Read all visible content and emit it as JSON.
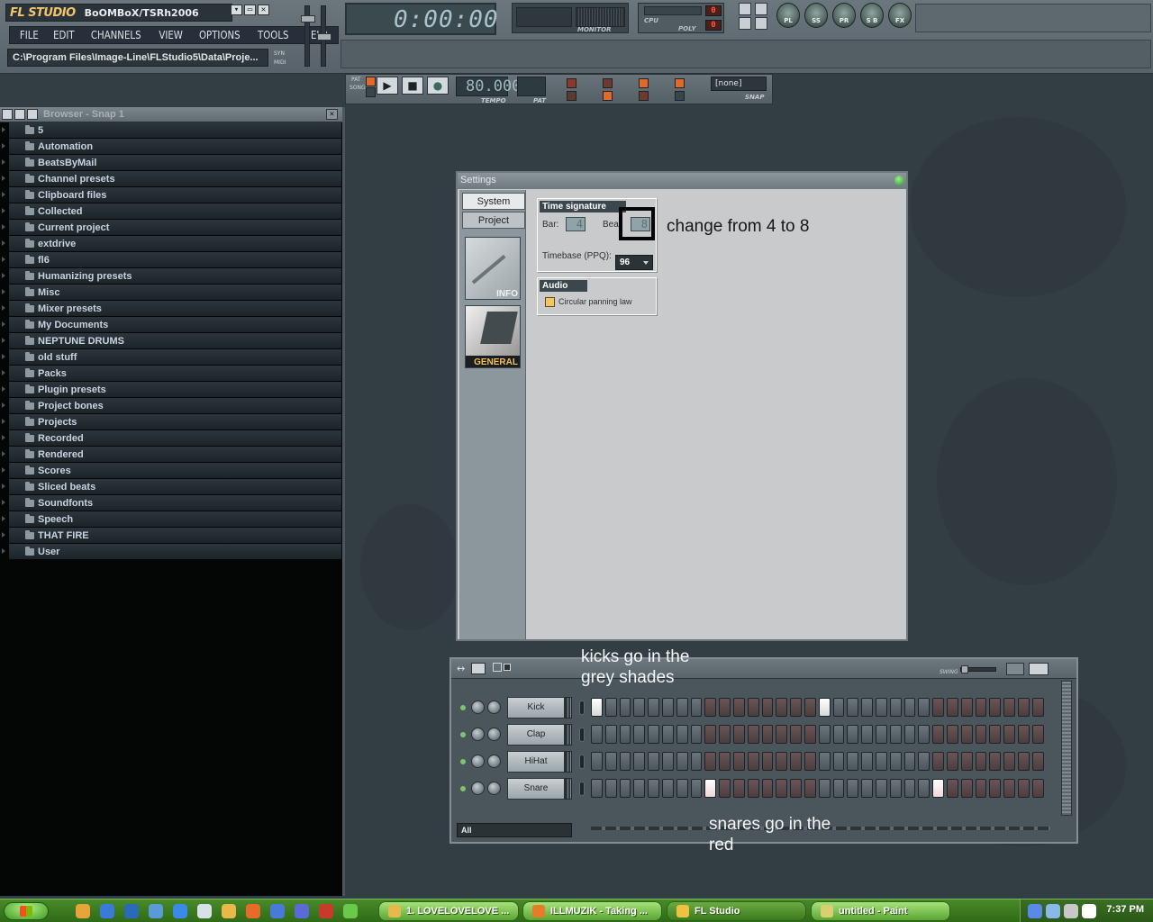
{
  "app": {
    "brand": "FL STUDIO",
    "project_name": "BoOMBoX/TSRh2006",
    "path": "C:\\Program Files\\Image-Line\\FLStudio5\\Data\\Proje...",
    "window_buttons": [
      "▾",
      "▭",
      "✕"
    ],
    "menu": [
      "FILE",
      "EDIT",
      "CHANNELS",
      "VIEW",
      "OPTIONS",
      "TOOLS",
      "HELP"
    ],
    "syn_label": "SYN",
    "midi_label": "MIDI"
  },
  "displays": {
    "time": "0:00:00",
    "monitor_label": "MONITOR",
    "cpu_label": "CPU",
    "poly_label": "POLY",
    "cpu_value": "0",
    "poly_value": "0",
    "view_buttons": [
      "PL",
      "SS",
      "PR",
      "S B",
      "FX"
    ]
  },
  "transport": {
    "pat_label": "PAT",
    "song_label": "SONG",
    "tempo_value": "80.000",
    "tempo_label": "TEMPO",
    "pat_label2": "PAT",
    "snap_value": "[none]",
    "snap_label": "SNAP",
    "play_icon": "▶",
    "stop_icon": "■",
    "record_icon": "●"
  },
  "browser": {
    "title": "Browser - Snap 1",
    "close": "✕",
    "items": [
      "5",
      "Automation",
      "BeatsByMail",
      "Channel presets",
      "Clipboard files",
      "Collected",
      "Current project",
      "extdrive",
      "fl6",
      "Humanizing presets",
      "Misc",
      "Mixer presets",
      "My Documents",
      "NEPTUNE DRUMS",
      "old stuff",
      "Packs",
      "Plugin presets",
      "Project bones",
      "Projects",
      "Recorded",
      "Rendered",
      "Scores",
      "Sliced beats",
      "Soundfonts",
      "Speech",
      "THAT FIRE",
      "User"
    ]
  },
  "settings": {
    "title": "Settings",
    "tabs": [
      "System",
      "Project"
    ],
    "thumb_info": "INFO",
    "thumb_general": "GENERAL",
    "time_signature_title": "Time signature",
    "bar_label": "Bar:",
    "bar_value": "4",
    "beat_label": "Beat",
    "beat_value": "8",
    "timebase_label": "Timebase (PPQ):",
    "timebase_value": "96",
    "audio_title": "Audio",
    "circular_panning_label": "Circular panning law"
  },
  "annotations": {
    "beat_note": "change from 4 to 8",
    "kicks_note": "kicks go in the grey shades",
    "snares_note": "snares go in the red"
  },
  "sequencer": {
    "swing_label": "SWING",
    "filter_value": "All",
    "step_pattern": [
      "g",
      "g",
      "g",
      "g",
      "g",
      "g",
      "g",
      "g",
      "r",
      "r",
      "r",
      "r",
      "r",
      "r",
      "r",
      "r",
      "g",
      "g",
      "g",
      "g",
      "g",
      "g",
      "g",
      "g",
      "r",
      "r",
      "r",
      "r",
      "r",
      "r",
      "r",
      "r"
    ],
    "channels": [
      {
        "name": "Kick",
        "active_steps": [
          0,
          16
        ]
      },
      {
        "name": "Clap",
        "active_steps": []
      },
      {
        "name": "HiHat",
        "active_steps": []
      },
      {
        "name": "Snare",
        "active_steps": [
          8,
          24
        ]
      }
    ]
  },
  "taskbar": {
    "start_label": "",
    "tasks": [
      {
        "label": "1. LOVELOVELOVE ...",
        "icon_color": "#e8b94a"
      },
      {
        "label": "ILLMUZIK - Taking ...",
        "icon_color": "#e87a2a"
      },
      {
        "label": "FL Studio",
        "icon_color": "#f0c040"
      },
      {
        "label": "untitled - Paint",
        "icon_color": "#d8d070"
      }
    ],
    "clock": "7:37 PM"
  },
  "colors": {
    "workspace_bg": "#333d44",
    "browser_bg": "#040606",
    "taskbar_green": "#3f8a22",
    "step_grey": "#5d676c",
    "step_red": "#5c4648"
  }
}
